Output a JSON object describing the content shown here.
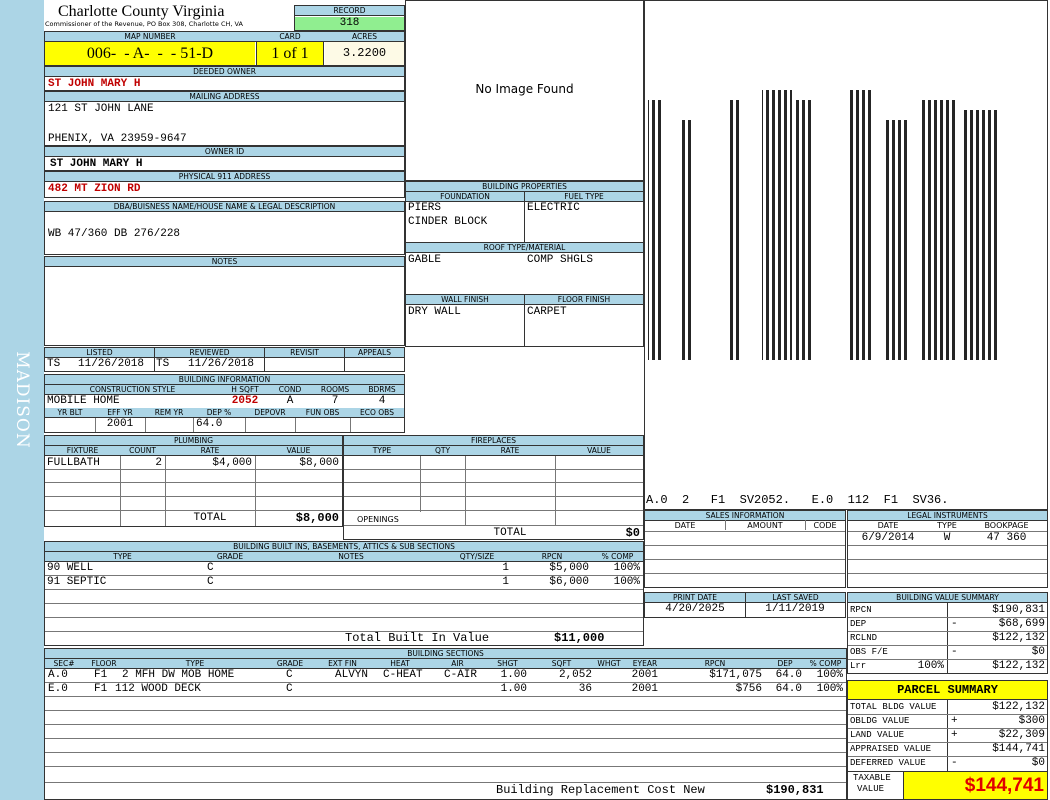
{
  "county_title": "Charlotte County Virginia",
  "county_sub": "Commissioner of the Revenue, PO Box 308, Charlotte CH, VA",
  "side_label": "MADISON",
  "record": {
    "label": "RECORD",
    "value": "318"
  },
  "map": {
    "label": "MAP NUMBER",
    "value": "006-  - A-  -  - 51-D"
  },
  "card": {
    "label": "CARD",
    "value": "1 of 1"
  },
  "acres": {
    "label": "ACRES",
    "value": "3.2200"
  },
  "owner": {
    "label": "DEEDED OWNER",
    "value": "ST JOHN MARY H"
  },
  "mailing": {
    "label": "MAILING ADDRESS",
    "line1": "121 ST JOHN LANE",
    "line2": "PHENIX, VA 23959-9647"
  },
  "owner_id": {
    "label": "OWNER ID",
    "value": "ST JOHN MARY H"
  },
  "physical": {
    "label": "PHYSICAL 911 ADDRESS",
    "value": "482 MT ZION RD"
  },
  "dba": {
    "label": "DBA/BUISNESS NAME/HOUSE NAME & LEGAL DESCRIPTION",
    "value": "WB 47/360 DB 276/228"
  },
  "notes": {
    "label": "NOTES"
  },
  "image_placeholder": "No Image Found",
  "sketch_caption": "A.0  2   F1  SV2052.   E.0  112  F1  SV36.",
  "building_props": {
    "label": "BUILDING PROPERTIES",
    "foundation_label": "FOUNDATION",
    "fuel_label": "FUEL TYPE",
    "foundation1": "PIERS",
    "foundation2": "CINDER BLOCK",
    "fuel": "ELECTRIC",
    "roof_label": "ROOF TYPE/MATERIAL",
    "roof1": "GABLE",
    "roof2": "COMP SHGLS",
    "wall_label": "WALL FINISH",
    "floor_label": "FLOOR FINISH",
    "wall": "DRY WALL",
    "floor": "CARPET"
  },
  "listing": {
    "listed_label": "LISTED",
    "reviewed_label": "REVIEWED",
    "revisit_label": "REVISIT",
    "appeals_label": "APPEALS",
    "listed_by": "TS",
    "listed_date": "11/26/2018",
    "reviewed_by": "TS",
    "reviewed_date": "11/26/2018"
  },
  "building_info": {
    "label": "BUILDING INFORMATION",
    "style_label": "CONSTRUCTION STYLE",
    "hsqft_label": "H SQFT",
    "cond_label": "COND",
    "rooms_label": "ROOMS",
    "bdrms_label": "BDRMS",
    "style": "MOBILE HOME",
    "hsqft": "2052",
    "cond": "A",
    "rooms": "7",
    "bdrms": "4",
    "yrblt_label": "YR BLT",
    "effyr_label": "EFF YR",
    "remyr_label": "REM YR",
    "dep_label": "DEP %",
    "depovr_label": "DEPOVR",
    "funobs_label": "FUN OBS",
    "ecoobs_label": "ECO OBS",
    "effyr": "2001",
    "dep": "64.0"
  },
  "plumbing": {
    "label": "PLUMBING",
    "headers": [
      "FIXTURE",
      "COUNT",
      "RATE",
      "VALUE"
    ],
    "fixture": "FULLBATH",
    "count": "2",
    "rate": "$4,000",
    "value": "$8,000",
    "total_label": "TOTAL",
    "total": "$8,000"
  },
  "fireplaces": {
    "label": "FIREPLACES",
    "headers": [
      "TYPE",
      "QTY",
      "RATE",
      "VALUE"
    ],
    "openings_label": "OPENINGS",
    "total_label": "TOTAL",
    "total": "$0"
  },
  "builtins": {
    "label": "BUILDING BUILT INS, BASEMENTS, ATTICS & SUB SECTIONS",
    "headers": [
      "TYPE",
      "GRADE",
      "NOTES",
      "QTY/SIZE",
      "RPCN",
      "% COMP"
    ],
    "rows": [
      {
        "type": "90 WELL",
        "grade": "C",
        "qty": "1",
        "rpcn": "$5,000",
        "comp": "100%"
      },
      {
        "type": "91 SEPTIC",
        "grade": "C",
        "qty": "1",
        "rpcn": "$6,000",
        "comp": "100%"
      }
    ],
    "total_label": "Total Built In Value",
    "total": "$11,000"
  },
  "sales": {
    "label": "SALES INFORMATION",
    "headers": [
      "DATE",
      "AMOUNT",
      "CODE"
    ]
  },
  "legal": {
    "label": "LEGAL INSTRUMENTS",
    "headers": [
      "DATE",
      "TYPE",
      "BOOKPAGE"
    ],
    "date": "6/9/2014",
    "type": "W",
    "bookpage": "47 360"
  },
  "print": {
    "print_label": "PRINT DATE",
    "saved_label": "LAST SAVED",
    "print_date": "4/20/2025",
    "saved_date": "1/11/2019"
  },
  "value_summary": {
    "label": "BUILDING VALUE SUMMARY",
    "rpcn_label": "RPCN",
    "rpcn": "$190,831",
    "dep_label": "DEP",
    "dep_sign": "-",
    "dep": "$68,699",
    "rclnd_label": "RCLND",
    "rclnd": "$122,132",
    "obs_label": "OBS F/E",
    "obs_sign": "-",
    "obs": "$0",
    "lrr_label": "Lrr",
    "lrr_pct": "100%",
    "lrr": "$122,132"
  },
  "parcel": {
    "label": "PARCEL SUMMARY",
    "tbv_label": "TOTAL BLDG VALUE",
    "tbv": "$122,132",
    "obldg_label": "OBLDG VALUE",
    "obldg_sign": "+",
    "obldg": "$300",
    "land_label": "LAND VALUE",
    "land_sign": "+",
    "land": "$22,309",
    "appraised_label": "APPRAISED VALUE",
    "appraised": "$144,741",
    "deferred_label": "DEFERRED VALUE",
    "deferred_sign": "-",
    "deferred": "$0",
    "taxable_label1": "TAXABLE",
    "taxable_label2": "VALUE",
    "taxable": "$144,741"
  },
  "sections": {
    "label": "BUILDING SECTIONS",
    "headers": [
      "SEC#",
      "FLOOR",
      "TYPE",
      "GRADE",
      "EXT FIN",
      "HEAT",
      "AIR",
      "SHGT",
      "SQFT",
      "WHGT",
      "EYEAR",
      "RPCN",
      "DEP",
      "% COMP"
    ],
    "rows": [
      {
        "sec": "A.0",
        "floor": "F1",
        "type": "2 MFH DW MOB HOME",
        "grade": "C",
        "ext": "ALVYN",
        "heat": "C-HEAT",
        "air": "C-AIR",
        "shgt": "1.00",
        "sqft": "2,052",
        "eyear": "2001",
        "rpcn": "$171,075",
        "dep": "64.0",
        "comp": "100%"
      },
      {
        "sec": "E.0",
        "floor": "F1",
        "type": "112 WOOD DECK",
        "grade": "C",
        "ext": "",
        "heat": "",
        "air": "",
        "shgt": "1.00",
        "sqft": "36",
        "eyear": "2001",
        "rpcn": "$756",
        "dep": "64.0",
        "comp": "100%"
      }
    ],
    "total_label": "Building Replacement Cost New",
    "total": "$190,831"
  }
}
